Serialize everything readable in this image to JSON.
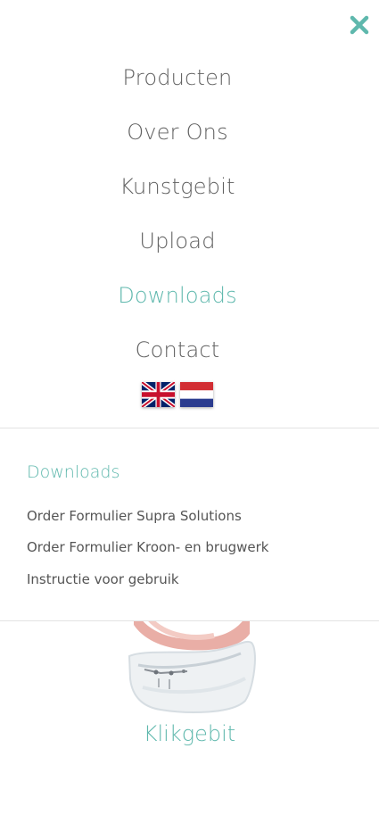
{
  "nav": {
    "items": [
      {
        "label": "Producten",
        "active": false
      },
      {
        "label": "Over Ons",
        "active": false
      },
      {
        "label": "Kunstgebit",
        "active": false
      },
      {
        "label": "Upload",
        "active": false
      },
      {
        "label": "Downloads",
        "active": true
      },
      {
        "label": "Contact",
        "active": false
      }
    ]
  },
  "languages": [
    {
      "icon": "uk-flag-icon",
      "code": "EN"
    },
    {
      "icon": "nl-flag-icon",
      "code": "NL"
    }
  ],
  "submenu": {
    "title": "Downloads",
    "links": [
      "Order Formulier Supra Solutions",
      "Order Formulier Kroon- en brugwerk",
      "Instructie voor gebruik"
    ]
  },
  "product": {
    "caption": "Klikgebit"
  },
  "colors": {
    "accent": "#5fb8ad",
    "text": "#606060",
    "divider": "#e3e3e3"
  }
}
